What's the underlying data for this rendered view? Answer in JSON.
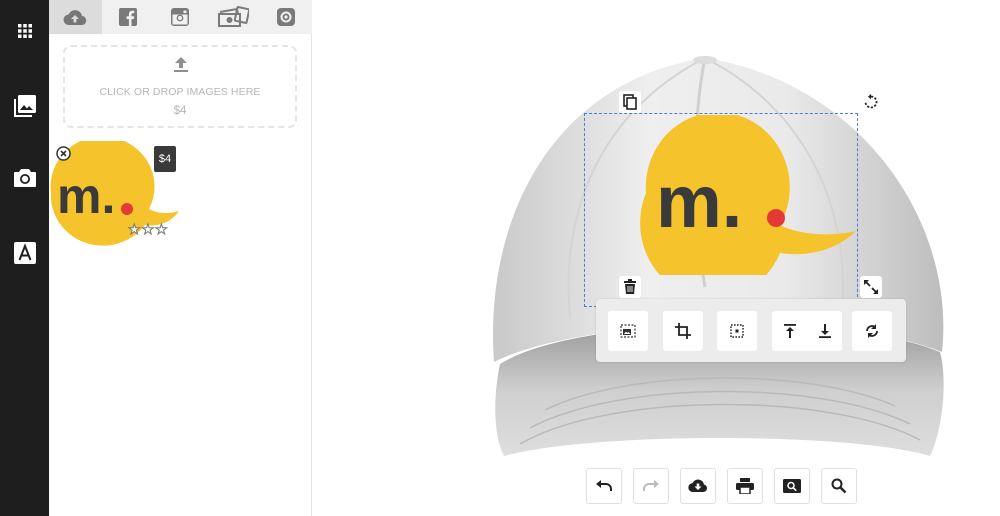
{
  "rail": {
    "items": [
      {
        "icon": "apps-grid-icon"
      },
      {
        "icon": "images-icon"
      },
      {
        "icon": "camera-icon"
      },
      {
        "icon": "text-icon"
      }
    ]
  },
  "tabs": [
    {
      "icon": "upload-cloud-icon",
      "active": true
    },
    {
      "icon": "facebook-icon"
    },
    {
      "icon": "instagram-icon"
    },
    {
      "icon": "photos-icon"
    },
    {
      "icon": "webcam-icon"
    }
  ],
  "upload": {
    "label": "CLICK OR DROP IMAGES HERE",
    "price": "$4"
  },
  "thumbnail": {
    "price": "$4",
    "rating_stars": 3,
    "logo_text": "m."
  },
  "colors": {
    "rail_bg": "#1e1e1e",
    "logo_yellow": "#f5c32c",
    "logo_dark": "#3a3a3a",
    "logo_red": "#e53935",
    "selection_blue": "#4a7fd6"
  },
  "design": {
    "logo_text": "m."
  },
  "toolbar": {
    "buttons": [
      "fit-image-icon",
      "crop-icon",
      "center-icon",
      "bring-front-icon",
      "send-back-icon",
      "flip-icon"
    ]
  },
  "bottom_bar": {
    "buttons": [
      "undo-icon",
      "redo-icon",
      "download-icon",
      "print-icon",
      "preview-icon",
      "zoom-icon"
    ]
  }
}
